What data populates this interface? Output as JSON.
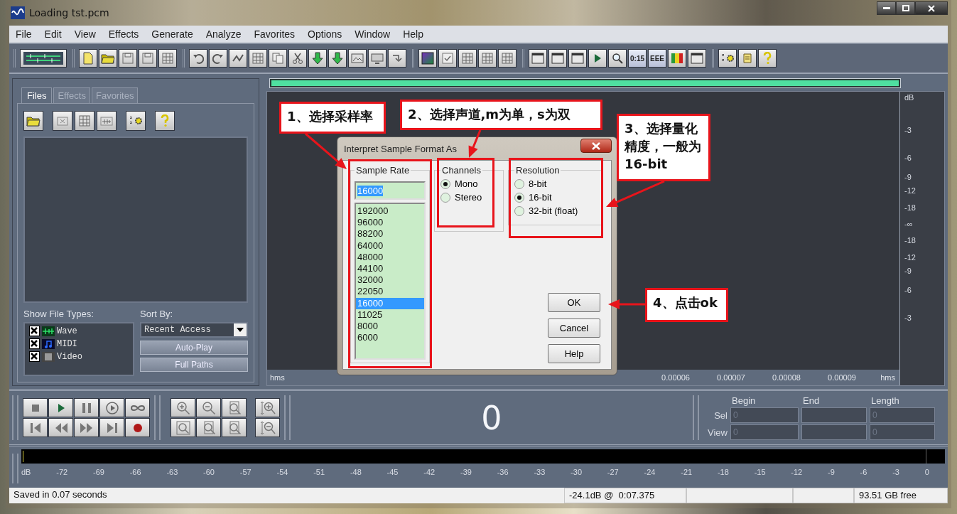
{
  "window": {
    "title": "Loading tst.pcm"
  },
  "menu": [
    "File",
    "Edit",
    "View",
    "Effects",
    "Generate",
    "Analyze",
    "Favorites",
    "Options",
    "Window",
    "Help"
  ],
  "toolbar": {
    "text_buttons": [
      "0:15",
      "EEE"
    ]
  },
  "organizer": {
    "tabs": [
      {
        "label": "Files",
        "selected": true
      },
      {
        "label": "Effects",
        "selected": false
      },
      {
        "label": "Favorites",
        "selected": false
      }
    ],
    "show_file_types_label": "Show File Types:",
    "file_types": [
      {
        "label": "Wave",
        "checked": true
      },
      {
        "label": "MIDI",
        "checked": true
      },
      {
        "label": "Video",
        "checked": true
      }
    ],
    "sort_by_label": "Sort By:",
    "sort_by": "Recent Access",
    "buttons": [
      "Auto-Play",
      "Full Paths"
    ]
  },
  "progress": {
    "level": 1
  },
  "time_axis": {
    "start_label": "hms",
    "labels": [
      "0.00006",
      "0.00007",
      "0.00008",
      "0.00009"
    ],
    "end_label": "hms"
  },
  "db_ruler": {
    "unit": "dB",
    "labels": [
      "-3",
      "-6",
      "-9",
      "-12",
      "-18",
      "-∞",
      "-18",
      "-12",
      "-9",
      "-6",
      "-3"
    ]
  },
  "dialog": {
    "title": "Interpret Sample Format As",
    "sample_rate": {
      "label": "Sample Rate",
      "value": "16000",
      "options": [
        {
          "label": "192000",
          "selected": false
        },
        {
          "label": "96000",
          "selected": false
        },
        {
          "label": "88200",
          "selected": false
        },
        {
          "label": "64000",
          "selected": false
        },
        {
          "label": "48000",
          "selected": false
        },
        {
          "label": "44100",
          "selected": false
        },
        {
          "label": "32000",
          "selected": false
        },
        {
          "label": "22050",
          "selected": false
        },
        {
          "label": "16000",
          "selected": true
        },
        {
          "label": "11025",
          "selected": false
        },
        {
          "label": "8000",
          "selected": false
        },
        {
          "label": "6000",
          "selected": false
        }
      ]
    },
    "channels": {
      "label": "Channels",
      "options": [
        {
          "label": "Mono",
          "selected": true
        },
        {
          "label": "Stereo",
          "selected": false
        }
      ]
    },
    "resolution": {
      "label": "Resolution",
      "options": [
        {
          "label": "8-bit",
          "selected": false
        },
        {
          "label": "16-bit",
          "selected": true
        },
        {
          "label": "32-bit (float)",
          "selected": false
        }
      ]
    },
    "buttons": [
      "OK",
      "Cancel",
      "Help"
    ]
  },
  "annotations": [
    {
      "text": "1、选择采样率"
    },
    {
      "text": "2、选择声道,m为单，s为双"
    },
    {
      "text": "3、选择量化精度，一般为16-bit"
    },
    {
      "text": "4、点击ok"
    }
  ],
  "transport": {
    "time": "0",
    "columns": [
      "Begin",
      "End",
      "Length"
    ],
    "rows": [
      {
        "label": "Sel",
        "begin": "0",
        "length": "0"
      },
      {
        "label": "View",
        "begin": "0",
        "length": "0"
      }
    ]
  },
  "level_meter": {
    "unit": "dB",
    "labels": [
      "-72",
      "-69",
      "-66",
      "-63",
      "-60",
      "-57",
      "-54",
      "-51",
      "-48",
      "-45",
      "-42",
      "-39",
      "-36",
      "-33",
      "-30",
      "-27",
      "-24",
      "-21",
      "-18",
      "-15",
      "-12",
      "-9",
      "-6",
      "-3",
      "0"
    ]
  },
  "status_bar": {
    "message": "Saved in 0.07 seconds",
    "cursor": "-24.1dB @  0:07.375",
    "free_space": "93.51 GB free"
  }
}
